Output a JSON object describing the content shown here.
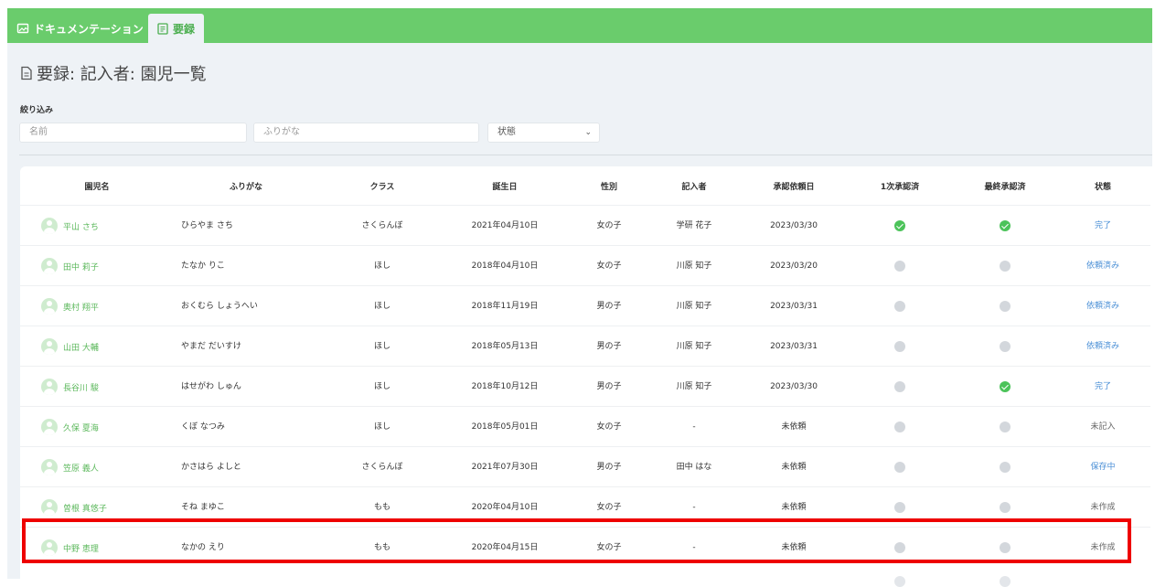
{
  "tabs": {
    "docs_label": "ドキュメンテーション",
    "active_label": "要録"
  },
  "page": {
    "title": "要録: 記入者: 園児一覧"
  },
  "filters": {
    "label": "絞り込み",
    "name_placeholder": "名前",
    "kana_placeholder": "ふりがな",
    "state_selected": "状態"
  },
  "table": {
    "headers": [
      "園児名",
      "ふりがな",
      "クラス",
      "誕生日",
      "性別",
      "記入者",
      "承認依頼日",
      "1次承認済",
      "最終承認済",
      "状態"
    ],
    "rows": [
      {
        "name": "平山 さち",
        "kana": "ひらやま さち",
        "class": "さくらんぼ",
        "birthday": "2021年04月10日",
        "gender": "女の子",
        "writer": "学研 花子",
        "request_date": "2023/03/30",
        "first_approved": true,
        "final_approved": true,
        "status": "完了"
      },
      {
        "name": "田中 莉子",
        "kana": "たなか りこ",
        "class": "ほし",
        "birthday": "2018年04月10日",
        "gender": "女の子",
        "writer": "川原 知子",
        "request_date": "2023/03/20",
        "first_approved": false,
        "final_approved": false,
        "status": "依頼済み"
      },
      {
        "name": "奥村 翔平",
        "kana": "おくむら しょうへい",
        "class": "ほし",
        "birthday": "2018年11月19日",
        "gender": "男の子",
        "writer": "川原 知子",
        "request_date": "2023/03/31",
        "first_approved": false,
        "final_approved": false,
        "status": "依頼済み"
      },
      {
        "name": "山田 大輔",
        "kana": "やまだ だいすけ",
        "class": "ほし",
        "birthday": "2018年05月13日",
        "gender": "男の子",
        "writer": "川原 知子",
        "request_date": "2023/03/31",
        "first_approved": false,
        "final_approved": false,
        "status": "依頼済み"
      },
      {
        "name": "長谷川 駿",
        "kana": "はせがわ しゅん",
        "class": "ほし",
        "birthday": "2018年10月12日",
        "gender": "男の子",
        "writer": "川原 知子",
        "request_date": "2023/03/30",
        "first_approved": false,
        "final_approved": true,
        "status": "完了"
      },
      {
        "name": "久保 夏海",
        "kana": "くぼ なつみ",
        "class": "ほし",
        "birthday": "2018年05月01日",
        "gender": "女の子",
        "writer": "-",
        "request_date": "未依頼",
        "first_approved": false,
        "final_approved": false,
        "status": "未記入"
      },
      {
        "name": "笠原 義人",
        "kana": "かさはら よしと",
        "class": "さくらんぼ",
        "birthday": "2021年07月30日",
        "gender": "男の子",
        "writer": "田中 はな",
        "request_date": "未依頼",
        "first_approved": false,
        "final_approved": false,
        "status": "保存中"
      },
      {
        "name": "曽根 真悠子",
        "kana": "そね まゆこ",
        "class": "もも",
        "birthday": "2020年04月10日",
        "gender": "女の子",
        "writer": "-",
        "request_date": "未依頼",
        "first_approved": false,
        "final_approved": false,
        "status": "未作成"
      },
      {
        "name": "中野 恵理",
        "kana": "なかの えり",
        "class": "もも",
        "birthday": "2020年04月15日",
        "gender": "女の子",
        "writer": "-",
        "request_date": "未依頼",
        "first_approved": false,
        "final_approved": false,
        "status": "未作成"
      }
    ]
  },
  "colors": {
    "topbar": "#6acc6c",
    "link": "#4a8fd6",
    "approved": "#4cc35a",
    "pending": "#d3d7dc",
    "highlight": "#ee0000"
  }
}
